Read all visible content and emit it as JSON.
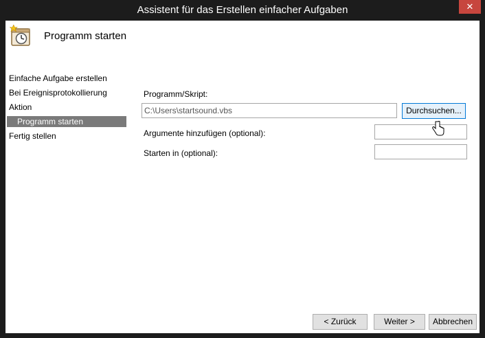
{
  "window": {
    "title": "Assistent für das Erstellen einfacher Aufgaben",
    "close_label": "✕"
  },
  "header": {
    "title": "Programm starten",
    "icon": "task-clock-icon"
  },
  "sidebar": {
    "items": [
      {
        "label": "Einfache Aufgabe erstellen",
        "active": false
      },
      {
        "label": "Bei Ereignisprotokollierung",
        "active": false
      },
      {
        "label": "Aktion",
        "active": false
      },
      {
        "label": "Programm starten",
        "active": true
      },
      {
        "label": "Fertig stellen",
        "active": false
      }
    ]
  },
  "form": {
    "program_label": "Programm/Skript:",
    "program_value": "C:\\Users\\startsound.vbs",
    "browse_label": "Durchsuchen...",
    "args_label": "Argumente hinzufügen (optional):",
    "args_value": "",
    "startin_label": "Starten in (optional):",
    "startin_value": ""
  },
  "footer": {
    "back_label": "< Zurück",
    "next_label": "Weiter >",
    "cancel_label": "Abbrechen"
  },
  "colors": {
    "title_bg": "#1c1c1c",
    "close_bg": "#c7463e",
    "active_nav_bg": "#7a7a7a"
  }
}
